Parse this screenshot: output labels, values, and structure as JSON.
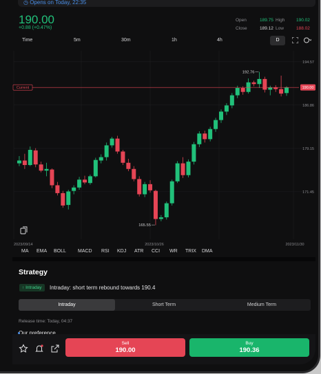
{
  "banner": {
    "text": "Opens on Today, 22:35"
  },
  "quote": {
    "price": "190.00",
    "change": "+0.88 (+0.47%)"
  },
  "ohlc": {
    "open_label": "Open",
    "open": "189.75",
    "high_label": "High",
    "high": "190.02",
    "close_label": "Close",
    "close": "189.12",
    "low_label": "Low",
    "low": "188.02"
  },
  "toolbar": {
    "time": "Time",
    "m5": "5m",
    "m30": "30m",
    "h1": "1h",
    "h4": "4h",
    "d": "D"
  },
  "chart": {
    "current_label": "Current",
    "current_price": "190.00",
    "y_ticks": [
      "194.57",
      "186.86",
      "179.15",
      "171.45"
    ],
    "x_ticks": [
      "2023/09/14",
      "2023/10/26",
      "2023/11/30"
    ],
    "high_annotation": "192.76",
    "low_annotation": "165.55"
  },
  "chart_data": {
    "type": "candlestick",
    "x_ticks": [
      "2023/09/14",
      "2023/10/26",
      "2023/11/30"
    ],
    "y_ticks": [
      194.57,
      186.86,
      179.15,
      171.45
    ],
    "current_price": 190.0,
    "annotations": {
      "high": 192.76,
      "low": 165.55
    },
    "candles": [
      [
        176.5,
        177.8,
        176.0,
        177.0
      ],
      [
        177.0,
        178.2,
        175.5,
        176.2
      ],
      [
        176.2,
        179.5,
        176.0,
        178.9
      ],
      [
        178.8,
        179.2,
        175.8,
        176.3
      ],
      [
        176.3,
        176.8,
        174.9,
        175.2
      ],
      [
        175.2,
        176.6,
        174.2,
        175.5
      ],
      [
        175.4,
        175.6,
        172.1,
        172.6
      ],
      [
        172.6,
        173.2,
        170.8,
        171.2
      ],
      [
        171.2,
        171.6,
        168.6,
        169.0
      ],
      [
        169.1,
        171.8,
        168.3,
        171.5
      ],
      [
        171.6,
        172.6,
        171.0,
        172.2
      ],
      [
        172.2,
        174.1,
        171.8,
        173.6
      ],
      [
        173.6,
        174.3,
        172.8,
        173.1
      ],
      [
        173.0,
        174.5,
        172.7,
        174.2
      ],
      [
        174.2,
        177.5,
        174.0,
        177.1
      ],
      [
        177.0,
        178.1,
        176.5,
        177.6
      ],
      [
        177.6,
        180.2,
        177.0,
        179.7
      ],
      [
        179.7,
        181.2,
        179.3,
        180.9
      ],
      [
        180.9,
        181.4,
        178.2,
        178.6
      ],
      [
        178.6,
        178.9,
        176.2,
        176.6
      ],
      [
        176.6,
        177.3,
        175.1,
        175.5
      ],
      [
        175.5,
        176.0,
        173.3,
        173.7
      ],
      [
        173.7,
        174.2,
        170.6,
        171.0
      ],
      [
        171.0,
        173.2,
        170.5,
        172.8
      ],
      [
        172.8,
        173.5,
        171.3,
        171.7
      ],
      [
        171.6,
        171.8,
        165.5,
        166.6
      ],
      [
        166.6,
        167.3,
        166.2,
        166.9
      ],
      [
        166.9,
        169.7,
        166.5,
        169.4
      ],
      [
        169.4,
        173.6,
        169.0,
        173.3
      ],
      [
        173.3,
        176.9,
        173.0,
        176.5
      ],
      [
        176.5,
        177.6,
        173.9,
        174.4
      ],
      [
        174.4,
        177.2,
        174.0,
        176.8
      ],
      [
        176.8,
        180.3,
        176.3,
        179.9
      ],
      [
        179.9,
        182.2,
        179.4,
        181.8
      ],
      [
        181.8,
        182.3,
        180.2,
        180.8
      ],
      [
        180.8,
        183.0,
        180.4,
        182.6
      ],
      [
        182.6,
        184.6,
        182.1,
        184.2
      ],
      [
        184.2,
        186.1,
        183.7,
        185.7
      ],
      [
        185.7,
        187.2,
        185.1,
        186.8
      ],
      [
        186.8,
        189.0,
        186.3,
        188.6
      ],
      [
        188.6,
        190.3,
        188.1,
        189.9
      ],
      [
        189.9,
        190.2,
        188.7,
        189.2
      ],
      [
        189.2,
        191.6,
        188.9,
        190.9
      ],
      [
        190.9,
        191.2,
        190.2,
        190.6
      ],
      [
        190.6,
        192.76,
        189.9,
        191.5
      ],
      [
        191.5,
        191.9,
        189.1,
        189.6
      ],
      [
        189.6,
        190.3,
        188.6,
        190.0
      ],
      [
        190.0,
        190.4,
        189.2,
        189.7
      ],
      [
        189.7,
        192.1,
        188.4,
        188.9
      ],
      [
        189.0,
        190.2,
        188.5,
        190.0
      ]
    ]
  },
  "indicators": [
    "MA",
    "EMA",
    "BOLL",
    "MACD",
    "RSI",
    "KDJ",
    "ATR",
    "CCI",
    "WR",
    "TRIX",
    "DMA"
  ],
  "strategy": {
    "title": "Strategy",
    "tag": "Intraday",
    "headline": "Intraday: short term rebound towards 190.4",
    "tabs": [
      "Intraday",
      "Short Term",
      "Medium Term"
    ],
    "release": "Release time: Today, 04:37",
    "preference": "Our preference"
  },
  "bottom": {
    "sell_label": "Sell",
    "sell_price": "190.00",
    "buy_label": "Buy",
    "buy_price": "190.36"
  },
  "colors": {
    "up": "#21c07a",
    "down": "#e54555",
    "accent": "#4a8fe8"
  }
}
